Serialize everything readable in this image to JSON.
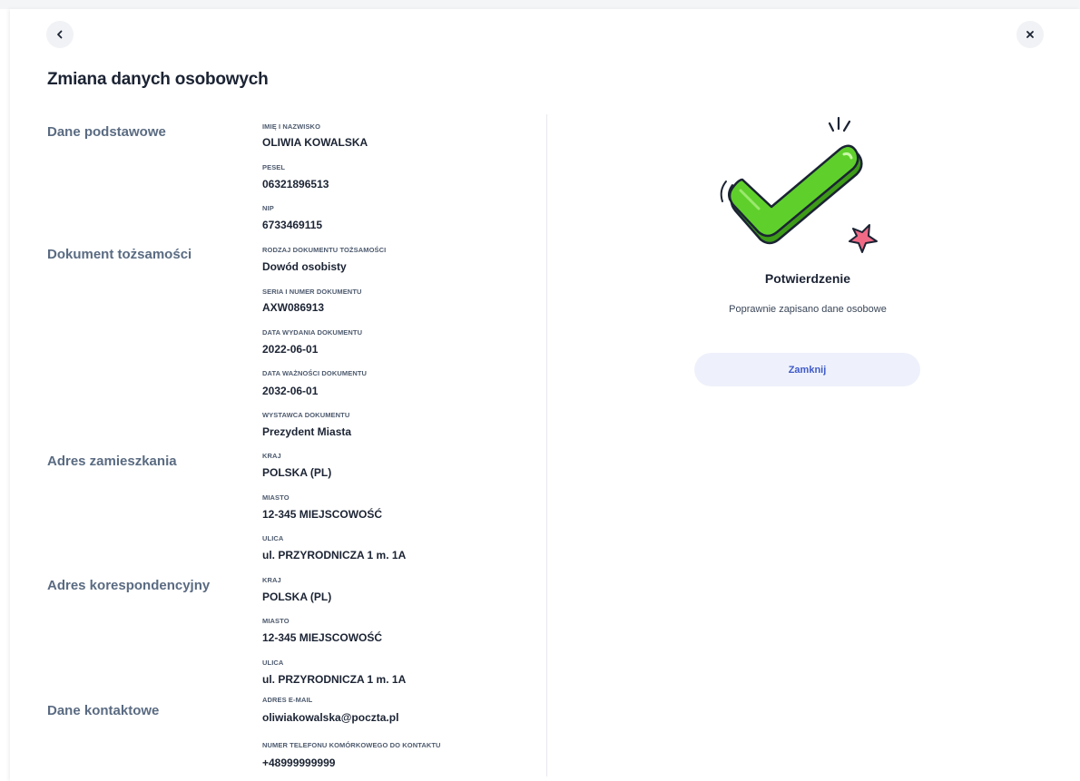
{
  "header": {
    "back_icon": "chevron-left-icon",
    "close_icon": "close-icon",
    "title": "Zmiana danych osobowych"
  },
  "sections": {
    "basic": "Dane podstawowe",
    "id_document": "Dokument tożsamości",
    "residence": "Adres zamieszkania",
    "correspondence": "Adres korespondencyjny",
    "contact": "Dane kontaktowe"
  },
  "fields": [
    {
      "label": "IMIĘ I NAZWISKO",
      "value": "OLIWIA KOWALSKA"
    },
    {
      "label": "PESEL",
      "value": "06321896513"
    },
    {
      "label": "NIP",
      "value": "6733469115"
    },
    {
      "label": "RODZAJ DOKUMENTU TOŻSAMOŚCI",
      "value": "Dowód osobisty"
    },
    {
      "label": "SERIA I NUMER DOKUMENTU",
      "value": "AXW086913"
    },
    {
      "label": "DATA WYDANIA DOKUMENTU",
      "value": "2022-06-01"
    },
    {
      "label": "DATA WAŻNOŚCI DOKUMENTU",
      "value": "2032-06-01"
    },
    {
      "label": "WYSTAWCA DOKUMENTU",
      "value": "Prezydent Miasta"
    },
    {
      "label": "KRAJ",
      "value": "POLSKA (PL)"
    },
    {
      "label": "MIASTO",
      "value": "12-345 MIEJSCOWOŚĆ"
    },
    {
      "label": "ULICA",
      "value": "ul. PRZYRODNICZA 1 m. 1A"
    },
    {
      "label": "KRAJ",
      "value": "POLSKA (PL)"
    },
    {
      "label": "MIASTO",
      "value": "12-345 MIEJSCOWOŚĆ"
    },
    {
      "label": "ULICA",
      "value": "ul. PRZYRODNICZA 1 m. 1A"
    },
    {
      "label": "ADRES E-MAIL",
      "value": "oliwiakowalska@poczta.pl"
    },
    {
      "label": "NUMER TELEFONU KOMÓRKOWEGO DO KONTAKTU",
      "value": "+48999999999"
    }
  ],
  "confirmation": {
    "illustration": "checkmark-success-icon",
    "title": "Potwierdzenie",
    "message": "Poprawnie zapisano dane osobowe",
    "close_label": "Zamknij"
  },
  "colors": {
    "check_green": "#5fd02b",
    "check_outline": "#1b2333",
    "button_bg": "#eef1fb",
    "button_text": "#3f5ac8",
    "star_pink": "#f06a86"
  }
}
